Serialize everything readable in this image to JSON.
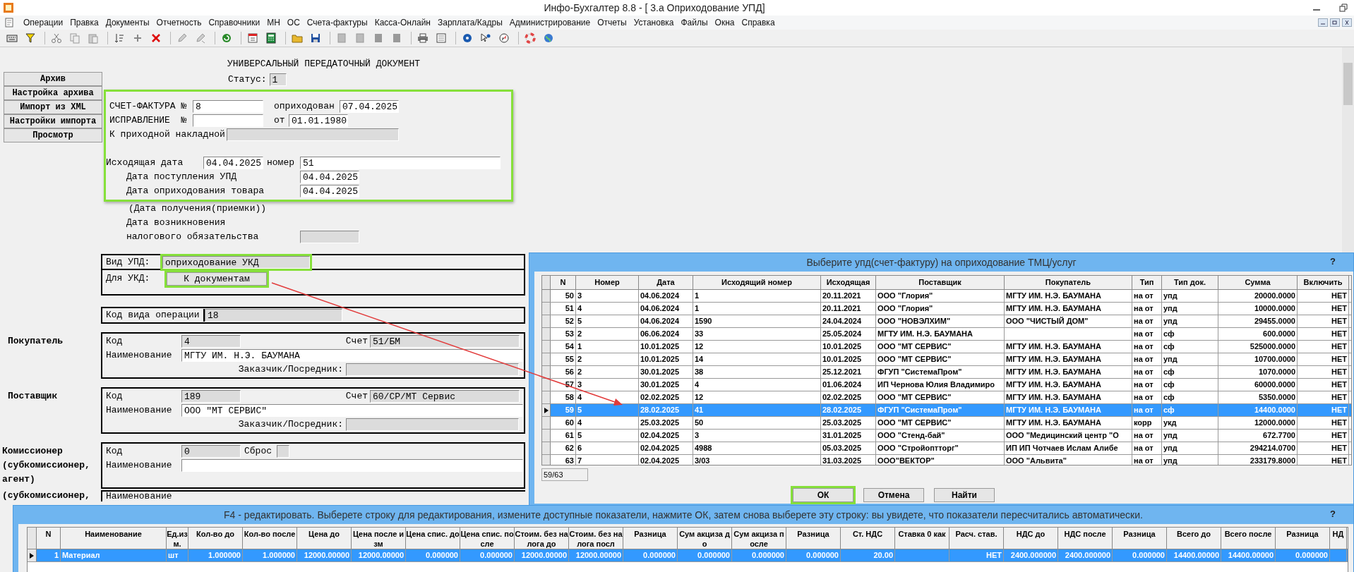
{
  "window": {
    "title": "Инфо-Бухгалтер 8.8 - [  3.а Оприходование УПД]"
  },
  "menu": [
    "Операции",
    "Правка",
    "Документы",
    "Отчетность",
    "Справочники",
    "МН",
    "ОС",
    "Счета-фактуры",
    "Касса-Онлайн",
    "Зарплата/Кадры",
    "Администрирование",
    "Отчеты",
    "Установка",
    "Файлы",
    "Окна",
    "Справка"
  ],
  "form": {
    "side_buttons": [
      "Архив",
      "Настройка архива",
      "Импорт из XML",
      "Настройки импорта",
      "Просмотр"
    ],
    "heading": "УНИВЕРСАЛЬНЫЙ ПЕРЕДАТОЧНЫЙ ДОКУМЕНТ",
    "status": {
      "label": "Статус:",
      "value": "1"
    },
    "details_highlighted": true,
    "invoice": {
      "label": "СЧЕТ-ФАКТУРА №",
      "value": "8",
      "posted_label": "оприходован",
      "posted_value": "07.04.2025"
    },
    "correction": {
      "label": "ИСПРАВЛЕНИЕ  №",
      "date_label": "от",
      "date_value": "01.01.1980"
    },
    "receipt_note": {
      "label": "К приходной накладной"
    },
    "outgoing": {
      "date_label": "Исходящая дата",
      "date_value": "04.04.2025",
      "number_label": "номер",
      "number_value": "51"
    },
    "dates": [
      {
        "label": "Дата поступления УПД",
        "value": "04.04.2025"
      },
      {
        "label": "Дата оприходования товара",
        "value": "04.04.2025"
      }
    ],
    "receipt_hint": "(Дата получения(приемки))",
    "tax_date": {
      "label_lines": [
        "Дата возникновения",
        "налогового обязательства"
      ]
    },
    "upd_type": {
      "label": "Вид УПД:",
      "value": "оприходование УКД",
      "value_highlighted": true,
      "ukd_label": "Для УКД:",
      "ukd_button": "К документам",
      "ukd_button_highlighted": true
    },
    "operation_code": {
      "label": "Код вида операции",
      "value": "18"
    },
    "parties": [
      {
        "title": "Покупатель",
        "code_label": "Код",
        "code": "4",
        "account_label": "Счет",
        "account": "51/БМ",
        "name_label": "Наименование",
        "name": "МГТУ ИМ. Н.Э. БАУМАНА",
        "agent_label": "Заказчик/Посредник:"
      },
      {
        "title": "Поставщик",
        "code_label": "Код",
        "code": "189",
        "account_label": "Счет",
        "account": "60/СР/МТ Сервис",
        "name_label": "Наименование",
        "name": "ООО \"МТ СЕРВИС\"",
        "agent_label": "Заказчик/Посредник:"
      }
    ],
    "commissioner": {
      "title_lines": [
        "Комиссионер",
        "(субкомиссионер,",
        "агент)"
      ],
      "code_label": "Код",
      "code": "0",
      "reset_label": "Сброс",
      "name_label": "Наименование"
    },
    "subcommissioner": {
      "title": "(субкомиссионер,",
      "name_label": "Наименование"
    }
  },
  "select_dialog": {
    "title": "Выберите упд(счет-фактуру) на оприходование ТМЦ/услуг",
    "help": "?",
    "columns": [
      "N",
      "Номер",
      "Дата",
      "Исходящий номер",
      "Исходящая",
      "Поставщик",
      "Покупатель",
      "Тип",
      "Тип док.",
      "Сумма",
      "Включить"
    ],
    "rows": [
      {
        "cells": [
          "50",
          "3",
          "04.06.2024",
          "1",
          "20.11.2021",
          "ООО \"Глория\"",
          "МГТУ ИМ. Н.Э. БАУМАНА",
          "на от",
          "упд",
          "20000.0000",
          "НЕТ"
        ],
        "selected": false
      },
      {
        "cells": [
          "51",
          "4",
          "04.06.2024",
          "1",
          "20.11.2021",
          "ООО \"Глория\"",
          "МГТУ ИМ. Н.Э. БАУМАНА",
          "на от",
          "упд",
          "10000.0000",
          "НЕТ"
        ],
        "selected": false
      },
      {
        "cells": [
          "52",
          "5",
          "04.06.2024",
          "1590",
          "24.04.2024",
          "ООО \"НОВЭЛХИМ\"",
          "ООО \"ЧИСТЫЙ ДОМ\"",
          "на от",
          "упд",
          "29455.0000",
          "НЕТ"
        ],
        "selected": false
      },
      {
        "cells": [
          "53",
          "2",
          "06.06.2024",
          "33",
          "25.05.2024",
          "МГТУ ИМ. Н.Э. БАУМАНА",
          null,
          "на от",
          "сф",
          "600.0000",
          "НЕТ"
        ],
        "selected": false
      },
      {
        "cells": [
          "54",
          "1",
          "10.01.2025",
          "12",
          "10.01.2025",
          "ООО \"МТ СЕРВИС\"",
          "МГТУ ИМ. Н.Э. БАУМАНА",
          "на от",
          "сф",
          "525000.0000",
          "НЕТ"
        ],
        "selected": false
      },
      {
        "cells": [
          "55",
          "2",
          "10.01.2025",
          "14",
          "10.01.2025",
          "ООО \"МТ СЕРВИС\"",
          "МГТУ ИМ. Н.Э. БАУМАНА",
          "на от",
          "упд",
          "10700.0000",
          "НЕТ"
        ],
        "selected": false
      },
      {
        "cells": [
          "56",
          "2",
          "30.01.2025",
          "38",
          "25.12.2021",
          "ФГУП \"СистемаПром\"",
          "МГТУ ИМ. Н.Э. БАУМАНА",
          "на от",
          "сф",
          "1070.0000",
          "НЕТ"
        ],
        "selected": false
      },
      {
        "cells": [
          "57",
          "3",
          "30.01.2025",
          "4",
          "01.06.2024",
          "ИП Чернова Юлия Владимиро",
          "МГТУ ИМ. Н.Э. БАУМАНА",
          "на от",
          "сф",
          "60000.0000",
          "НЕТ"
        ],
        "selected": false
      },
      {
        "cells": [
          "58",
          "4",
          "02.02.2025",
          "12",
          "02.02.2025",
          "ООО \"МТ СЕРВИС\"",
          "МГТУ ИМ. Н.Э. БАУМАНА",
          "на от",
          "сф",
          "5350.0000",
          "НЕТ"
        ],
        "selected": false
      },
      {
        "cells": [
          "59",
          "5",
          "28.02.2025",
          "41",
          "28.02.2025",
          "ФГУП \"СистемаПром\"",
          "МГТУ ИМ. Н.Э. БАУМАНА",
          "на от",
          "сф",
          "14400.0000",
          "НЕТ"
        ],
        "selected": true
      },
      {
        "cells": [
          "60",
          "4",
          "25.03.2025",
          "50",
          "25.03.2025",
          "ООО \"МТ СЕРВИС\"",
          "МГТУ ИМ. Н.Э. БАУМАНА",
          "корр",
          "укд",
          "12000.0000",
          "НЕТ"
        ],
        "selected": false
      },
      {
        "cells": [
          "61",
          "5",
          "02.04.2025",
          "3",
          "31.01.2025",
          "ООО \"Стенд-бай\"",
          "ООО \"Медицинский центр \"О",
          "на от",
          "упд",
          "672.7700",
          "НЕТ"
        ],
        "selected": false
      },
      {
        "cells": [
          "62",
          "6",
          "02.04.2025",
          "4988",
          "05.03.2025",
          "ООО \"Стройоптторг\"",
          "ИП ИП Чотчаев Ислам Алибе",
          "на от",
          "упд",
          "294214.0700",
          "НЕТ"
        ],
        "selected": false
      },
      {
        "cells": [
          "63",
          "7",
          "02.04.2025",
          "3/03",
          "31.03.2025",
          "ООО\"ВЕКТОР\"",
          "ООО \"Альвита\"",
          "на от",
          "упд",
          "233179.8000",
          "НЕТ"
        ],
        "selected": false
      }
    ],
    "counter": "59/63",
    "buttons": [
      {
        "label": "ОК",
        "highlighted": true
      },
      {
        "label": "Отмена",
        "highlighted": false
      },
      {
        "label": "Найти",
        "highlighted": false
      }
    ]
  },
  "edit_dialog": {
    "title": "F4 - редактировать. Выберете строку для редактирования, измените доступные показатели, нажмите ОК, затем снова выберете эту строку: вы увидете, что показатели пересчитались автоматически.",
    "help": "?",
    "columns": [
      "N",
      "Наименование",
      "Ед.изм.",
      "Кол-во до",
      "Кол-во после",
      "Цена до",
      "Цена после изм",
      "Цена спис. до",
      "Цена спис. после",
      "Стоим. без налога до",
      "Стоим. без налога посл",
      "Разница",
      "Сум акциза до",
      "Сум акциза после",
      "Разница",
      "Ст. НДС",
      "Ставка 0 как",
      "Расч. став.",
      "НДС до",
      "НДС после",
      "Разница",
      "Всего до",
      "Всего после",
      "Разница",
      "НД"
    ],
    "rows": [
      {
        "cells": [
          "1",
          "Материал",
          "шт",
          "1.000000",
          "1.000000",
          "12000.00000",
          "12000.00000",
          "0.000000",
          "0.000000",
          "12000.00000",
          "12000.00000",
          "0.000000",
          "0.000000",
          "0.000000",
          "0.000000",
          "20.00",
          null,
          "НЕТ",
          "2400.000000",
          "2400.000000",
          "0.000000",
          "14400.00000",
          "14400.00000",
          "0.000000",
          null
        ],
        "selected": true
      }
    ]
  }
}
